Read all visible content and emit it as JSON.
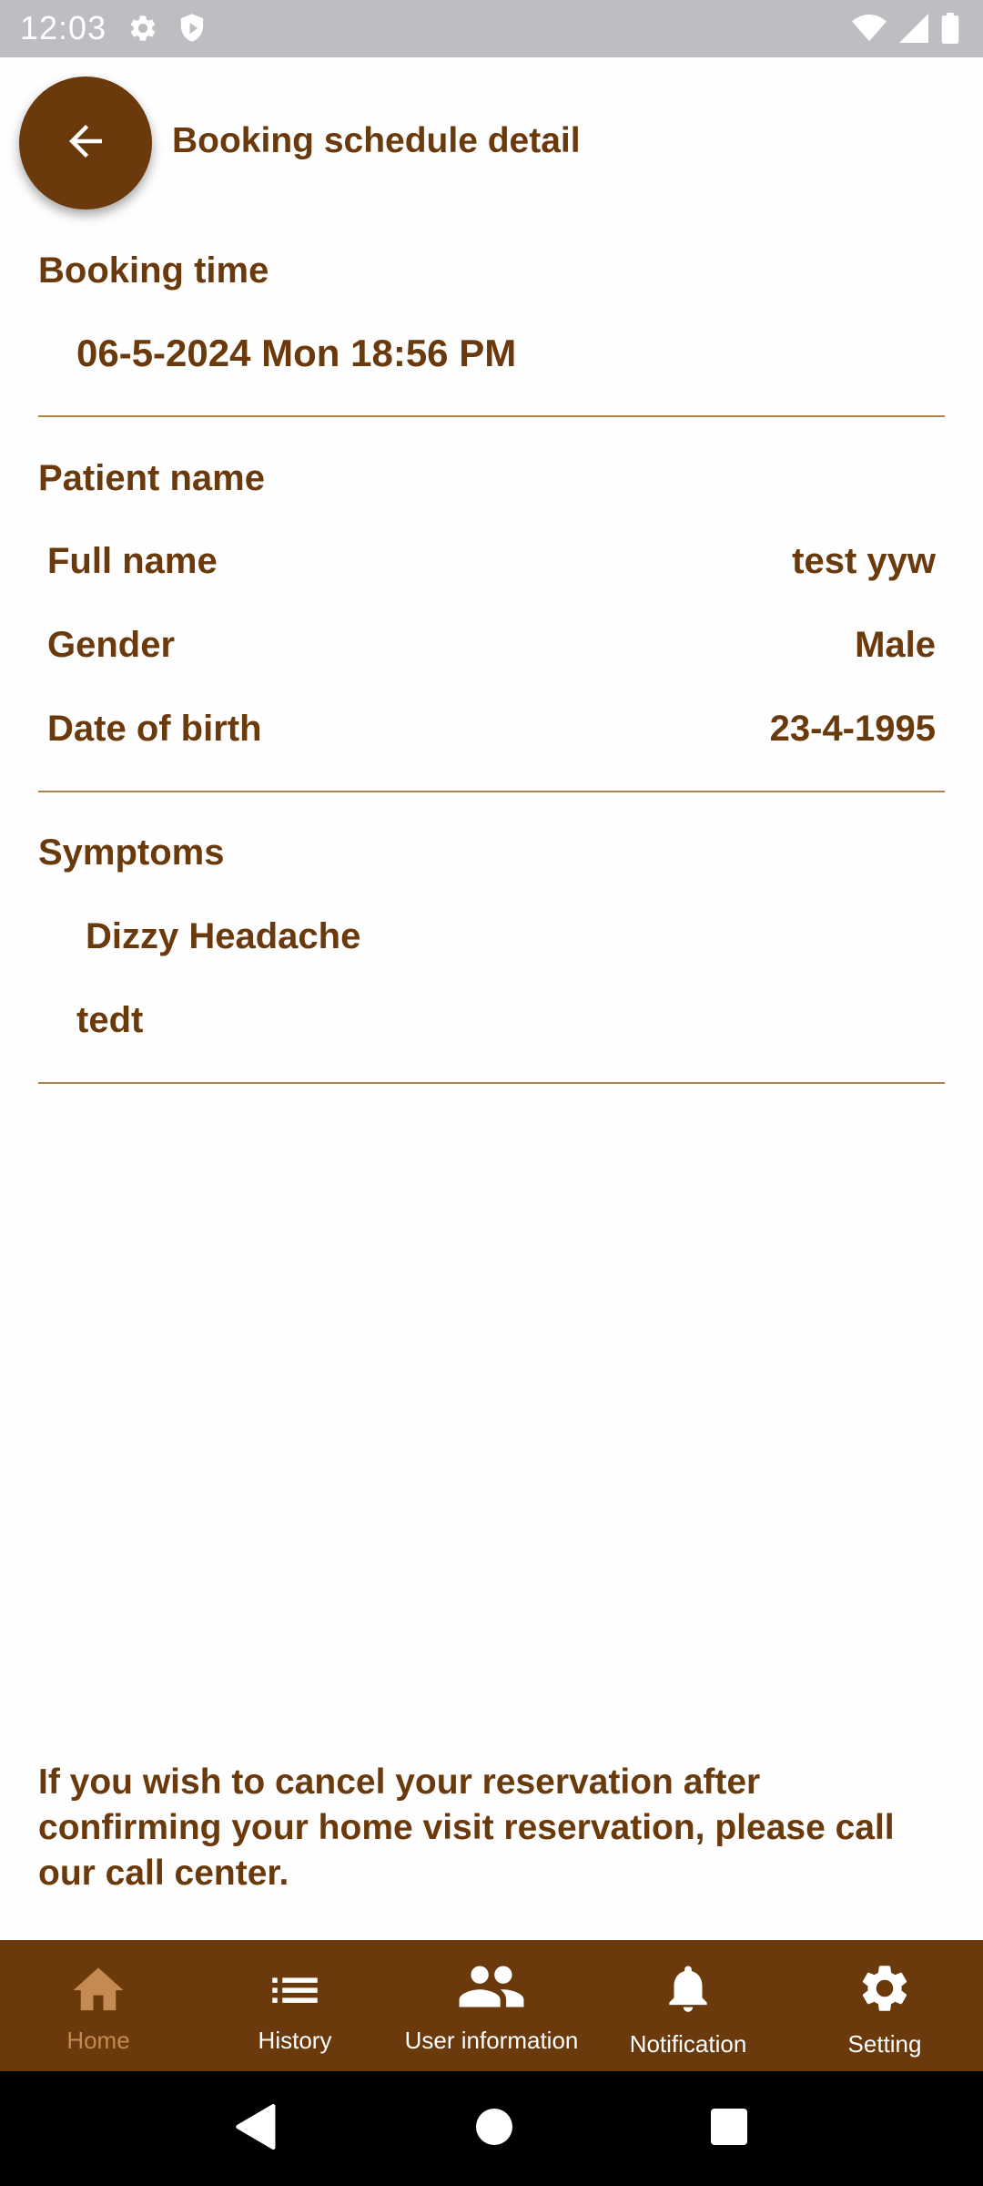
{
  "status_bar": {
    "time": "12:03",
    "left_icons": [
      "gear-icon",
      "shield-icon"
    ],
    "right_icons": [
      "wifi-icon",
      "signal-icon",
      "battery-icon"
    ]
  },
  "header": {
    "back_icon": "arrow-left-icon",
    "title": "Booking schedule detail"
  },
  "booking_time": {
    "title": "Booking time",
    "value": "06-5-2024 Mon 18:56 PM"
  },
  "patient": {
    "title": "Patient name",
    "rows": [
      {
        "label": "Full name",
        "value": "test yyw"
      },
      {
        "label": "Gender",
        "value": "Male"
      },
      {
        "label": "Date of birth",
        "value": "23-4-1995"
      }
    ]
  },
  "symptoms": {
    "title": "Symptoms",
    "selected": "Dizzy Headache",
    "note": "tedt"
  },
  "cancel_note": "If you wish to cancel your reservation after confirming your home visit reservation, please call our call center.",
  "bottom_nav": {
    "items": [
      {
        "label": "Home",
        "icon": "home-icon",
        "active": true
      },
      {
        "label": "History",
        "icon": "list-icon",
        "active": false
      },
      {
        "label": "User information",
        "icon": "people-icon",
        "active": false
      },
      {
        "label": "Notification",
        "icon": "bell-icon",
        "active": false
      },
      {
        "label": "Setting",
        "icon": "gear-icon",
        "active": false
      }
    ]
  },
  "colors": {
    "brand_brown": "#6a390c",
    "active_tab": "#c48a52",
    "divider": "#a9844e",
    "status_bar": "#bebdc2"
  }
}
